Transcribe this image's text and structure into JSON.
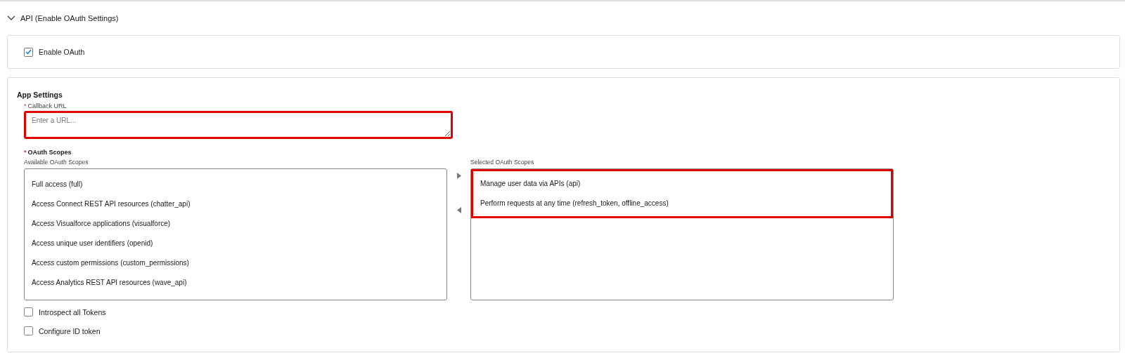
{
  "section": {
    "title": "API (Enable OAuth Settings)",
    "expanded": true
  },
  "enable_oauth": {
    "label": "Enable OAuth",
    "checked": true
  },
  "app_settings": {
    "title": "App Settings",
    "callback_url": {
      "required_mark": "*",
      "label": "Callback URL",
      "placeholder": "Enter a URL...",
      "highlighted": true
    },
    "oauth_scopes": {
      "required_mark": "*",
      "label": "OAuth Scopes",
      "available": {
        "label": "Available OAuth Scopes",
        "items": [
          "Full access (full)",
          "Access Connect REST API resources (chatter_api)",
          "Access Visualforce applications (visualforce)",
          "Access unique user identifiers (openid)",
          "Access custom permissions (custom_permissions)",
          "Access Analytics REST API resources (wave_api)"
        ]
      },
      "selected": {
        "label": "Selected OAuth Scopes",
        "highlighted": true,
        "items": [
          "Manage user data via APIs (api)",
          "Perform requests at any time (refresh_token, offline_access)"
        ]
      }
    },
    "options": [
      {
        "label": "Introspect all Tokens",
        "checked": false
      },
      {
        "label": "Configure ID token",
        "checked": false
      }
    ]
  }
}
